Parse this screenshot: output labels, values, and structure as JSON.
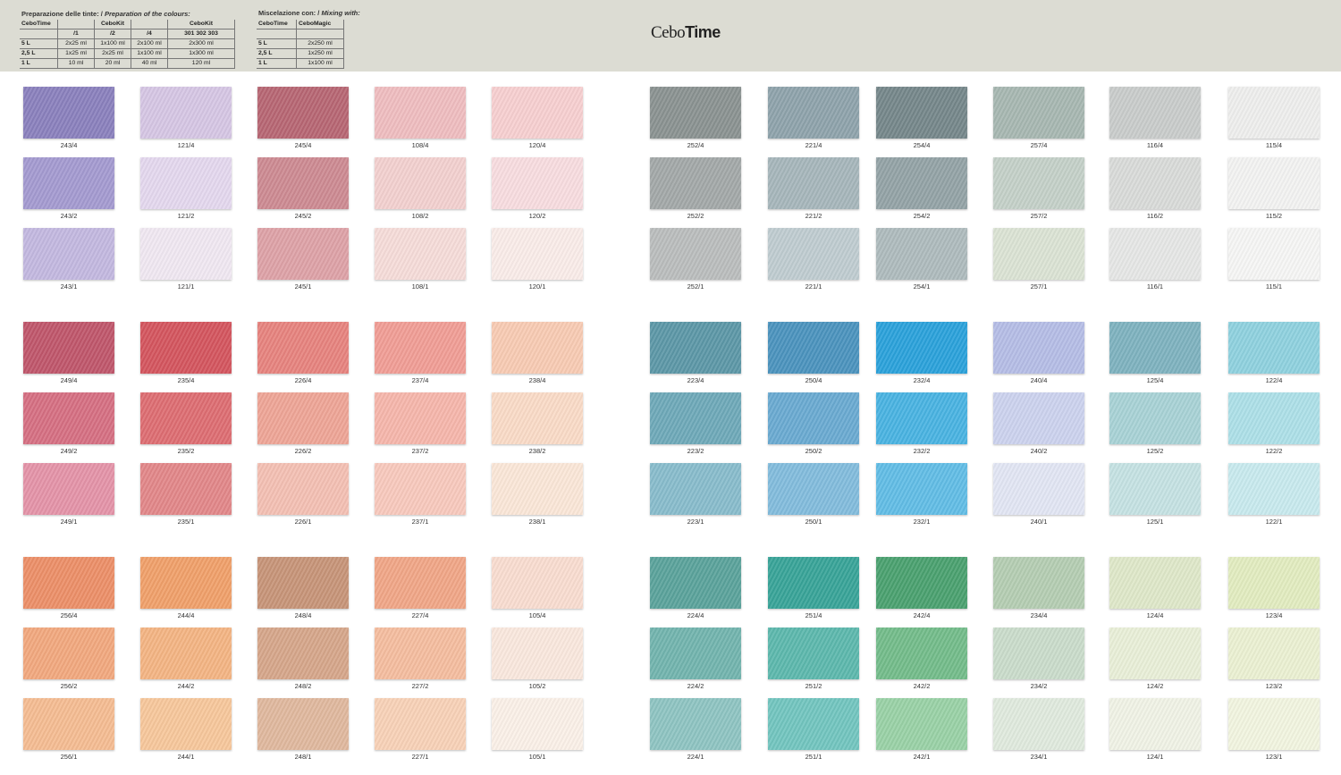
{
  "header": {
    "left_caption": "Preparazione delle tinte: / ",
    "left_caption_italic": "Preparation of the colours:",
    "right_caption": "Miscelazione con: / ",
    "right_caption_italic": "Mixing with:",
    "brand_light": "Cebo",
    "brand_bold": "Time"
  },
  "prep_table": {
    "header1": [
      "CeboTime",
      "",
      "CeboKit",
      "",
      "CeboKit"
    ],
    "header2": [
      "",
      "/1",
      "/2",
      "/4",
      "301  302  303"
    ],
    "rows": [
      [
        "5 L",
        "2x25 ml",
        "1x100 ml",
        "2x100 ml",
        "2x300 ml"
      ],
      [
        "2,5 L",
        "1x25 ml",
        "2x25 ml",
        "1x100 ml",
        "1x300 ml"
      ],
      [
        "1 L",
        "10 ml",
        "20 ml",
        "40 ml",
        "120 ml"
      ]
    ]
  },
  "mix_table": {
    "header": [
      "CeboTime",
      "CeboMagic"
    ],
    "rows": [
      [
        "5 L",
        "2x250 ml"
      ],
      [
        "2,5 L",
        "1x250 ml"
      ],
      [
        "1 L",
        "1x100 ml"
      ]
    ]
  },
  "left_swatches": [
    [
      [
        "243/4",
        "#8a80bd"
      ],
      [
        "121/4",
        "#d6c6e4"
      ],
      [
        "245/4",
        "#b76673"
      ],
      [
        "108/4",
        "#efbdc0"
      ],
      [
        "120/4",
        "#f7cfd0"
      ]
    ],
    [
      [
        "243/2",
        "#a49ad0"
      ],
      [
        "121/2",
        "#e4d8ee"
      ],
      [
        "245/2",
        "#cd8a92"
      ],
      [
        "108/2",
        "#f3d0cf"
      ],
      [
        "120/2",
        "#f8dde0"
      ]
    ],
    [
      [
        "243/1",
        "#c3b8e0"
      ],
      [
        "121/1",
        "#f0e8f2"
      ],
      [
        "245/1",
        "#dea2a7"
      ],
      [
        "108/1",
        "#f6dcd9"
      ],
      [
        "120/1",
        "#faece9"
      ]
    ],
    [
      [
        "249/4",
        "#c0566b"
      ],
      [
        "235/4",
        "#d4555e"
      ],
      [
        "226/4",
        "#e7837e"
      ],
      [
        "237/4",
        "#f19d95"
      ],
      [
        "238/4",
        "#f8cbb3"
      ]
    ],
    [
      [
        "249/2",
        "#d66f82"
      ],
      [
        "235/2",
        "#de6d72"
      ],
      [
        "226/2",
        "#eea596"
      ],
      [
        "237/2",
        "#f6b6ab"
      ],
      [
        "238/2",
        "#fadbc7"
      ]
    ],
    [
      [
        "249/1",
        "#e493a8"
      ],
      [
        "235/1",
        "#e28789"
      ],
      [
        "226/1",
        "#f4c0b3"
      ],
      [
        "237/1",
        "#f8c9bd"
      ],
      [
        "238/1",
        "#fbe7d8"
      ]
    ],
    [
      [
        "256/4",
        "#ec8f68"
      ],
      [
        "244/4",
        "#f0a06a"
      ],
      [
        "248/4",
        "#c79478"
      ],
      [
        "227/4",
        "#f1a687"
      ],
      [
        "105/4",
        "#f9ddd0"
      ]
    ],
    [
      [
        "256/2",
        "#f2a87e"
      ],
      [
        "244/2",
        "#f4b483"
      ],
      [
        "248/2",
        "#d6a68a"
      ],
      [
        "227/2",
        "#f5bd9f"
      ],
      [
        "105/2",
        "#fae8de"
      ]
    ],
    [
      [
        "256/1",
        "#f5bc92"
      ],
      [
        "244/1",
        "#f7c79b"
      ],
      [
        "248/1",
        "#e0b89e"
      ],
      [
        "227/1",
        "#f8d1b7"
      ],
      [
        "105/1",
        "#fbf0e8"
      ]
    ]
  ],
  "right_swatches": [
    [
      [
        "252/4",
        "#8a9291"
      ],
      [
        "221/4",
        "#8ea3ab"
      ],
      [
        "254/4",
        "#75878a"
      ],
      [
        "257/4",
        "#a7b7b1"
      ],
      [
        "116/4",
        "#c9cccb"
      ],
      [
        "115/4",
        "#eeeeed"
      ]
    ],
    [
      [
        "252/2",
        "#a3a8a8"
      ],
      [
        "221/2",
        "#a6b6bb"
      ],
      [
        "254/2",
        "#93a3a6"
      ],
      [
        "257/2",
        "#c4d0c8"
      ],
      [
        "116/2",
        "#d9dbd9"
      ],
      [
        "115/2",
        "#f3f3f2"
      ]
    ],
    [
      [
        "252/1",
        "#babdbd"
      ],
      [
        "221/1",
        "#bfccd0"
      ],
      [
        "254/1",
        "#aebbbd"
      ],
      [
        "257/1",
        "#dbe3d4"
      ],
      [
        "116/1",
        "#e6e7e6"
      ],
      [
        "115/1",
        "#f6f6f5"
      ]
    ],
    [
      [
        "223/4",
        "#5c97a7"
      ],
      [
        "250/4",
        "#4b93be"
      ],
      [
        "232/4",
        "#2aa2db"
      ],
      [
        "240/4",
        "#b5bde6"
      ],
      [
        "125/4",
        "#7eb2bf"
      ],
      [
        "122/4",
        "#8fd1df"
      ]
    ],
    [
      [
        "223/2",
        "#6ea9b9"
      ],
      [
        "250/2",
        "#6aaad1"
      ],
      [
        "232/2",
        "#49b3e2"
      ],
      [
        "240/2",
        "#ccd2ee"
      ],
      [
        "125/2",
        "#a8d2d6"
      ],
      [
        "122/2",
        "#ade0e8"
      ]
    ],
    [
      [
        "223/1",
        "#88bccc"
      ],
      [
        "250/1",
        "#82bcdd"
      ],
      [
        "232/1",
        "#61bde6"
      ],
      [
        "240/1",
        "#e2e6f4"
      ],
      [
        "125/1",
        "#c5e2e3"
      ],
      [
        "122/1",
        "#c8eaee"
      ]
    ],
    [
      [
        "224/4",
        "#5aa39b"
      ],
      [
        "251/4",
        "#38a498"
      ],
      [
        "242/4",
        "#4aa16f"
      ],
      [
        "234/4",
        "#b4cdb2"
      ],
      [
        "124/4",
        "#dfe8c9"
      ],
      [
        "123/4",
        "#e2ecc0"
      ]
    ],
    [
      [
        "224/2",
        "#72b4ae"
      ],
      [
        "251/2",
        "#5cb8ad"
      ],
      [
        "242/2",
        "#73bc8a"
      ],
      [
        "234/2",
        "#cadccb"
      ],
      [
        "124/2",
        "#e9efd8"
      ],
      [
        "123/2",
        "#ebf1d2"
      ]
    ],
    [
      [
        "224/1",
        "#8ec4c2"
      ],
      [
        "251/1",
        "#72c5bf"
      ],
      [
        "242/1",
        "#99d1a6"
      ],
      [
        "234/1",
        "#e0eade"
      ],
      [
        "124/1",
        "#f0f3e6"
      ],
      [
        "123/1",
        "#f2f5e0"
      ]
    ]
  ]
}
